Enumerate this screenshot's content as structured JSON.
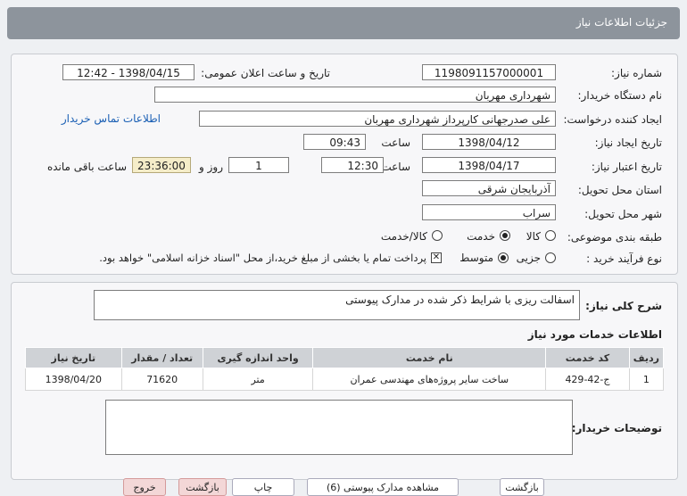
{
  "header": {
    "title": "جزئیات اطلاعات نیاز"
  },
  "form": {
    "need_number_label": "شماره نیاز:",
    "need_number": "1198091157000001",
    "announce_label": "تاریخ و ساعت اعلان عمومی:",
    "announce_value": "1398/04/15 - 12:42",
    "buyer_org_label": "نام دستگاه خریدار:",
    "buyer_org": "شهرداری مهربان",
    "requester_label": "ایجاد کننده درخواست:",
    "requester": "علی  صدرجهانی  کارپرداز شهرداری مهربان",
    "contact_link": "اطلاعات تماس خریدار",
    "created_label": "تاریخ ایجاد نیاز:",
    "created_date": "1398/04/12",
    "time_label": "ساعت",
    "created_time": "09:43",
    "validity_label": "تاریخ اعتبار نیاز:",
    "validity_date": "1398/04/17",
    "validity_time": "12:30",
    "days": "1",
    "days_label": "روز و",
    "remaining_time": "23:36:00",
    "remaining_label": "ساعت باقی مانده",
    "province_label": "استان محل تحویل:",
    "province": "آذربایجان شرقی",
    "city_label": "شهر محل تحویل:",
    "city": "سراب",
    "category_label": "طبقه بندی موضوعی:",
    "category_options": [
      "کالا",
      "خدمت",
      "کالا/خدمت"
    ],
    "category_selected": "خدمت",
    "process_label": "نوع فرآیند خرید :",
    "process_options": [
      "جزیی",
      "متوسط"
    ],
    "process_selected": "متوسط",
    "payment_note": "پرداخت تمام یا بخشی از مبلغ خرید،از محل \"اسناد خزانه اسلامی\" خواهد بود."
  },
  "description": {
    "label": "شرح کلی نیاز:",
    "value": "اسفالت ریزی با شرایط ذکر شده در مدارک پیوستی"
  },
  "services": {
    "title": "اطلاعات خدمات مورد نیاز",
    "columns": [
      "ردیف",
      "کد خدمت",
      "نام خدمت",
      "واحد اندازه گیری",
      "تعداد / مقدار",
      "تاریخ نیاز"
    ],
    "rows": [
      [
        "1",
        "ج-42-429",
        "ساخت سایر پروژه‌های مهندسی عمران",
        "متر",
        "71620",
        "1398/04/20"
      ]
    ]
  },
  "buyer_notes": {
    "label": "توضیحات خریدار:",
    "value": ""
  },
  "footer": {
    "buttons": [
      "بازگشت",
      "مشاهده مدارک پیوستی (6)",
      "چاپ",
      "بازگشت",
      "خروج"
    ]
  }
}
